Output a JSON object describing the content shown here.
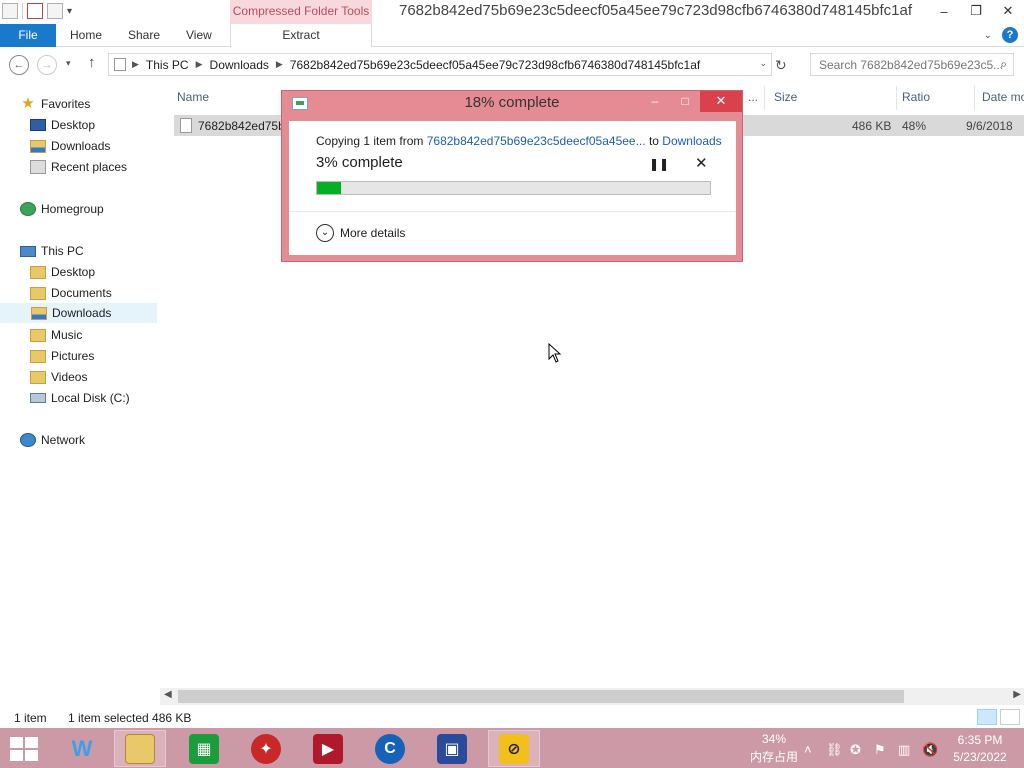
{
  "window": {
    "title": "7682b842ed75b69e23c5deecf05a45ee79c723d98cfb6746380d748145bfc1af",
    "context_tab_group": "Compressed Folder Tools"
  },
  "ribbon": {
    "tabs": [
      {
        "label": "File"
      },
      {
        "label": "Home"
      },
      {
        "label": "Share"
      },
      {
        "label": "View"
      },
      {
        "label": "Extract"
      }
    ],
    "help": "?"
  },
  "address": {
    "crumbs": [
      "This PC",
      "Downloads",
      "7682b842ed75b69e23c5deecf05a45ee79c723d98cfb6746380d748145bfc1af"
    ],
    "search_placeholder": "Search 7682b842ed75b69e23c5..."
  },
  "nav": {
    "favorites": "Favorites",
    "fav_items": [
      "Desktop",
      "Downloads",
      "Recent places"
    ],
    "homegroup": "Homegroup",
    "this_pc": "This PC",
    "pc_items": [
      "Desktop",
      "Documents",
      "Downloads",
      "Music",
      "Pictures",
      "Videos",
      "Local Disk (C:)"
    ],
    "network": "Network",
    "selected": "Downloads"
  },
  "columns": {
    "name": "Name",
    "truncated": "...",
    "size": "Size",
    "ratio": "Ratio",
    "date": "Date mo"
  },
  "files": [
    {
      "name": "7682b842ed75b6",
      "size": "486 KB",
      "ratio": "48%",
      "date": "9/6/2018"
    }
  ],
  "status": {
    "count": "1 item",
    "selected": "1 item selected  486 KB"
  },
  "dialog": {
    "title": "18% complete",
    "copying_prefix": "Copying 1 item from ",
    "source": "7682b842ed75b69e23c5deecf05a45ee...",
    "to": " to ",
    "destination": "Downloads",
    "percent_text": "3% complete",
    "progress_fraction": 0.06,
    "more_details": "More details"
  },
  "taskbar": {
    "apps": [
      "windows-store",
      "file-explorer",
      "store",
      "antivirus",
      "video-recorder",
      "browser",
      "photo-tool",
      "ld-player"
    ],
    "mem_percent": "34%",
    "mem_label": "内存占用",
    "time": "6:35 PM",
    "date": "5/23/2022"
  },
  "colors": {
    "accent": "#1979ca",
    "dialog_frame": "#e58b94",
    "progress": "#06b025",
    "taskbar": "#cc9aa6"
  }
}
